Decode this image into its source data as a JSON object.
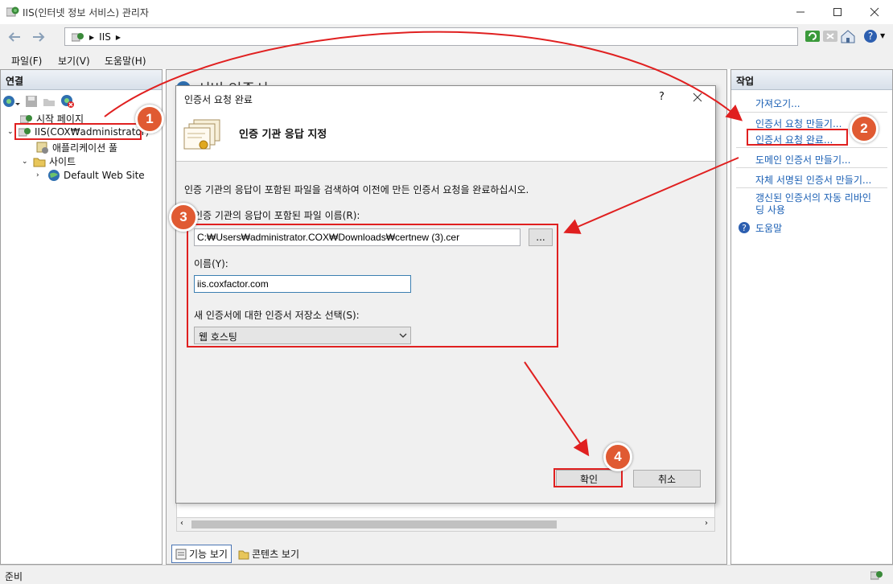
{
  "window": {
    "title": "IIS(인터넷 정보 서비스) 관리자"
  },
  "address": {
    "crumbs": [
      "IIS"
    ]
  },
  "menu": {
    "items": [
      "파일(F)",
      "보기(V)",
      "도움말(H)"
    ]
  },
  "connections": {
    "header": "연결",
    "tree": [
      {
        "label": "시작 페이지"
      },
      {
        "label": "IIS(COX₩administrator)"
      },
      {
        "label": "애플리케이션 풀"
      },
      {
        "label": "사이트"
      },
      {
        "label": "Default Web Site"
      }
    ]
  },
  "center": {
    "bg_title": "서버 인증서",
    "tabs": {
      "features": "기능 보기",
      "content": "콘텐츠 보기"
    }
  },
  "actions": {
    "header": "작업",
    "items": [
      {
        "label": "가져오기..."
      },
      {
        "label": "인증서 요청 만들기..."
      },
      {
        "label": "인증서 요청 완료..."
      },
      {
        "label": "도메인 인증서 만들기..."
      },
      {
        "label": "자체 서명된 인증서 만들기..."
      },
      {
        "label": "갱신된 인증서의 자동 리바인"
      },
      {
        "label": "딩 사용"
      },
      {
        "label": "도움말"
      }
    ]
  },
  "status": {
    "text": "준비"
  },
  "dialog": {
    "title": "인증서 요청 완료",
    "help": "?",
    "heading": "인증 기관 응답 지정",
    "description": "인증 기관의 응답이 포함된 파일을 검색하여 이전에 만든 인증서 요청을 완료하십시오.",
    "file_label": "인증 기관의 응답이 포함된 파일 이름(R):",
    "file_value": "C:₩Users₩administrator.COX₩Downloads₩certnew (3).cer",
    "browse": "...",
    "name_label": "이름(Y):",
    "name_value": "iis.coxfactor.com",
    "store_label": "새 인증서에 대한 인증서 저장소 선택(S):",
    "store_value": "웹 호스팅",
    "ok": "확인",
    "cancel": "취소"
  },
  "badges": [
    "1",
    "2",
    "3",
    "4"
  ],
  "colors": {
    "annotation": "#e02020",
    "badge": "#e05a32",
    "link": "#1a5fb4"
  }
}
